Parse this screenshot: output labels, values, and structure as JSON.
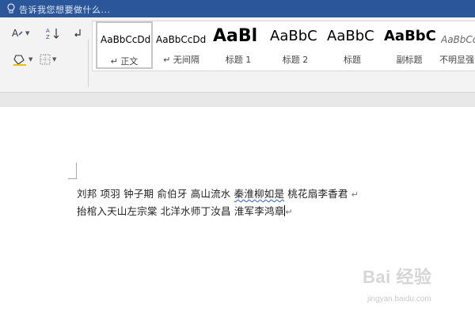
{
  "tell_me": {
    "text": "告诉我您想要做什么..."
  },
  "styles": [
    {
      "sample": "AaBbCcDd",
      "label": "↵ 正文",
      "selected": true
    },
    {
      "sample": "AaBbCcDd",
      "label": "↵ 无间隔",
      "selected": false
    },
    {
      "sample": "AaBl",
      "label": "标题 1",
      "selected": false
    },
    {
      "sample": "AaBbC",
      "label": "标题 2",
      "selected": false
    },
    {
      "sample": "AaBbC",
      "label": "标题",
      "selected": false
    },
    {
      "sample": "AaBbC",
      "label": "副标题",
      "selected": false
    },
    {
      "sample": "AaBbCcD",
      "label": "不明显强调",
      "selected": false
    }
  ],
  "document": {
    "line1_part1": "刘邦 项羽 钟子期 俞伯牙 高山流水 ",
    "line1_flagged": "秦淮柳如是",
    "line1_part2": " 桃花扇李香君",
    "line2": "抬棺入天山左宗棠 北洋水师丁汝昌 淮军李鸿章",
    "paragraph_mark": "↵"
  },
  "watermark": {
    "brand": "Bai 经验",
    "sub": "jingyan.baidu.com"
  },
  "colors": {
    "title_bar": "#2b579a",
    "ribbon": "#f3f3f3",
    "spell_underline": "#2f5fd0"
  },
  "icons": [
    "lightbulb-icon",
    "text-effects-icon",
    "sort-icon",
    "show-marks-icon",
    "shading-icon",
    "borders-icon",
    "dialog-launcher-icon"
  ]
}
